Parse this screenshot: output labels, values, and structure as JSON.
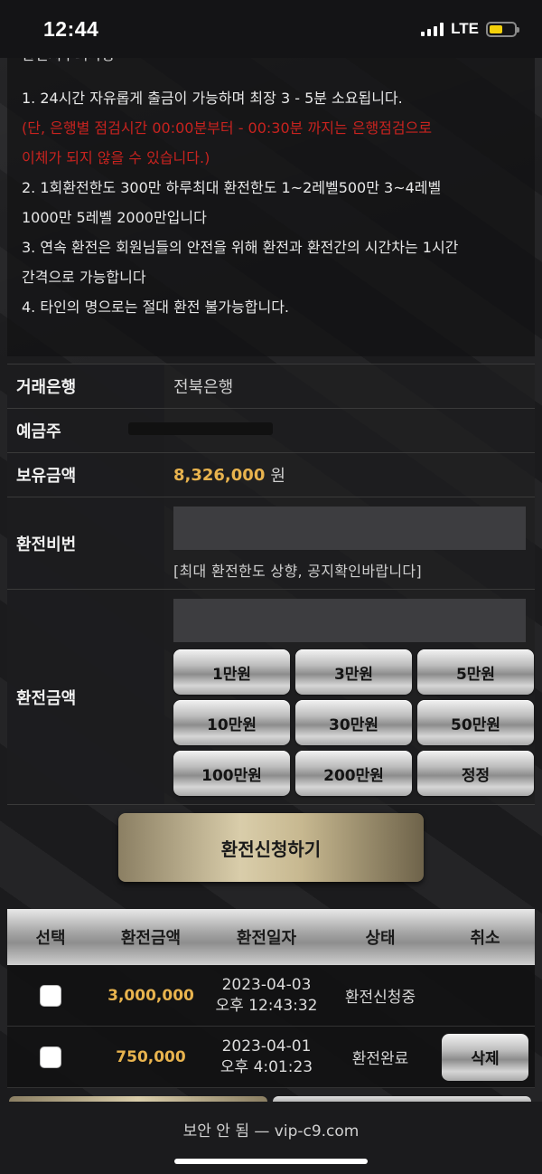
{
  "status_bar": {
    "time": "12:44",
    "network": "LTE"
  },
  "notice": {
    "cut_title": "환전시주의사항",
    "lines": [
      {
        "text": "1. 24시간 자유롭게 출금이 가능하며 최장 3 - 5분 소요됩니다.",
        "red": false
      },
      {
        "text": "(단, 은행별 점검시간 00:00분부터 - 00:30분 까지는 은행점검으로",
        "red": true
      },
      {
        "text": "이체가 되지 않을 수 있습니다.)",
        "red": true
      },
      {
        "text": "2. 1회환전한도 300만 하루최대 환전한도 1~2레벨500만 3~4레벨",
        "red": false
      },
      {
        "text": "1000만 5레벨 2000만입니다",
        "red": false
      },
      {
        "text": "3. 연속 환전은 회원님들의 안전을 위해 환전과 환전간의 시간차는 1시간",
        "red": false
      },
      {
        "text": "간격으로 가능합니다",
        "red": false
      },
      {
        "text": "4. 타인의 명으로는 절대 환전 불가능합니다.",
        "red": false
      }
    ]
  },
  "form": {
    "bank_label": "거래은행",
    "bank_value": "전북은행",
    "holder_label": "예금주",
    "balance_label": "보유금액",
    "balance_value": "8,326,000",
    "balance_unit": "원",
    "password_label": "환전비번",
    "password_hint": "[최대 환전한도 상향, 공지확인바랍니다]",
    "amount_label": "환전금액",
    "amount_buttons": [
      "1만원",
      "3만원",
      "5만원",
      "10만원",
      "30만원",
      "50만원",
      "100만원",
      "200만원",
      "정정"
    ],
    "submit_label": "환전신청하기"
  },
  "history": {
    "headers": [
      "선택",
      "환전금액",
      "환전일자",
      "상태",
      "취소"
    ],
    "rows": [
      {
        "amount": "3,000,000",
        "date": "2023-04-03",
        "time": "오후 12:43:32",
        "status": "환전신청중",
        "cancel": ""
      },
      {
        "amount": "750,000",
        "date": "2023-04-01",
        "time": "오후 4:01:23",
        "status": "환전완료",
        "cancel": "삭제"
      }
    ]
  },
  "browser": {
    "url_text": "보안 안 됨 — vip-c9.com"
  },
  "colors": {
    "accent_gold": "#e8b34e",
    "warning_red": "#c8231f"
  }
}
